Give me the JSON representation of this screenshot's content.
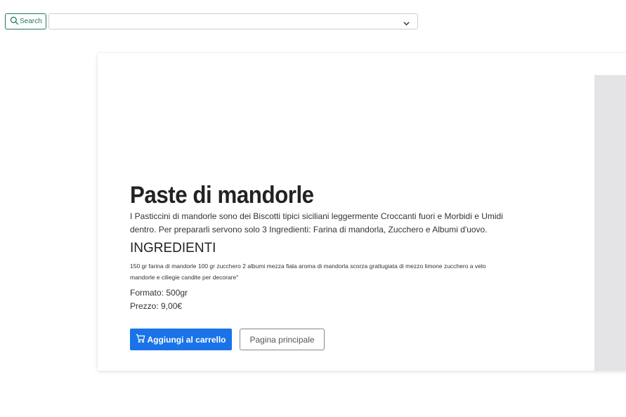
{
  "search": {
    "button_label": "Search",
    "icon": "search-icon",
    "select_value": "",
    "chevron": "chevron-down-icon"
  },
  "product": {
    "title": "Paste di mandorle",
    "description": "I Pasticcini di mandorle sono dei Biscotti tipici siciliani leggermente Croccanti fuori e Morbidi e Umidi dentro. Per prepararli servono solo 3 Ingredienti: Farina di mandorla, Zucchero e Albumi d'uovo.",
    "ingredients_heading": "INGREDIENTI",
    "ingredients_text": "150 gr farina di mandorle 100 gr zucchero 2 albumi mezza fiala aroma di mandorla scorza grattugiata di mezzo limone zucchero a velo mandorle e ciliegie candite per decorare\"",
    "format": "Formato: 500gr",
    "price": "Prezzo: 9,00€"
  },
  "actions": {
    "add_to_cart": "Aggiungi al carrello",
    "add_to_cart_icon": "cart-icon",
    "home": "Pagina principale"
  },
  "colors": {
    "accent": "#1a73e8",
    "search_border": "#1f7a5a",
    "image_placeholder": "#e4e4e6"
  }
}
